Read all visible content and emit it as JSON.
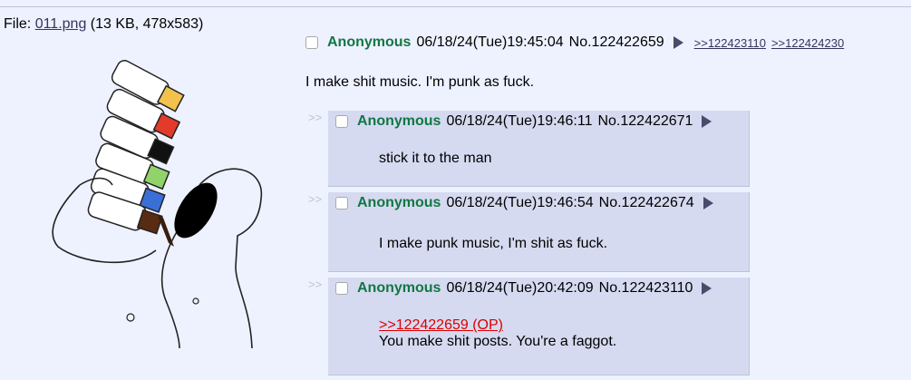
{
  "file": {
    "label": "File:",
    "filename": "011.png",
    "meta": "(13 KB, 478x583)"
  },
  "op": {
    "name": "Anonymous",
    "datetime": "06/18/24(Tue)19:45:04",
    "number": "No.122422659",
    "backlinks": [
      ">>122423110",
      ">>122424230"
    ],
    "message": "I make shit music. I'm punk as fuck."
  },
  "replies": [
    {
      "arrows": ">>",
      "name": "Anonymous",
      "datetime": "06/18/24(Tue)19:46:11",
      "number": "No.122422671",
      "message": "stick it to the man"
    },
    {
      "arrows": ">>",
      "name": "Anonymous",
      "datetime": "06/18/24(Tue)19:46:54",
      "number": "No.122422674",
      "message": "I make punk music, I'm shit as fuck."
    },
    {
      "arrows": ">>",
      "name": "Anonymous",
      "datetime": "06/18/24(Tue)20:42:09",
      "number": "No.122423110",
      "quote": ">>122422659 (OP)",
      "message": "You make shit posts. You're a faggot."
    }
  ],
  "colors": {
    "background": "#eef2ff",
    "reply_bg": "#d6daf0",
    "name_green": "#117743",
    "quote_red": "#dd0000",
    "link": "#34345c"
  },
  "icons": {
    "checkbox": "checkbox-icon",
    "menu": "post-menu-triangle-icon"
  }
}
